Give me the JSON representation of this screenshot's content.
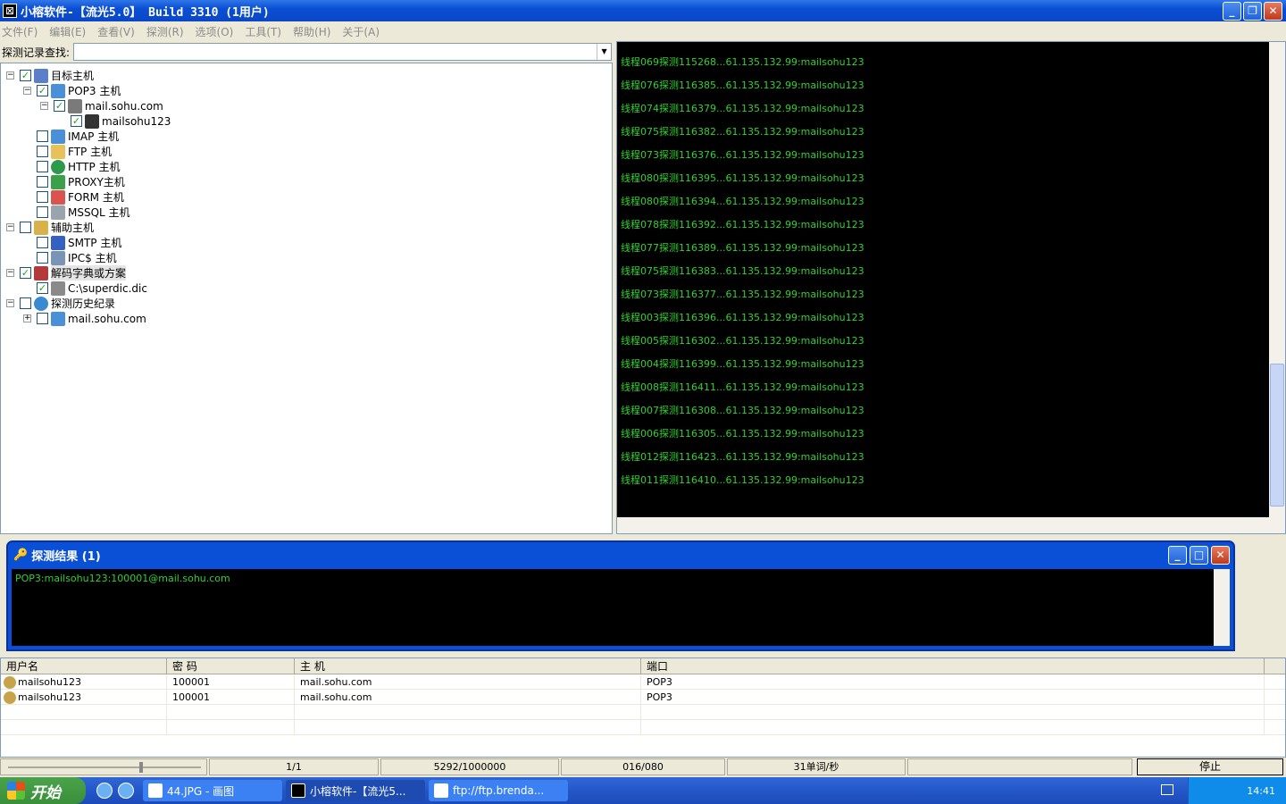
{
  "window": {
    "title": "小榕软件-【流光5.0】 Build 3310 (1用户)"
  },
  "menu": [
    "文件(F)",
    "编辑(E)",
    "查看(V)",
    "探测(R)",
    "选项(O)",
    "工具(T)",
    "帮助(H)",
    "关于(A)"
  ],
  "search": {
    "label": "探测记录查找:",
    "value": ""
  },
  "tree": {
    "target_hosts": "目标主机",
    "pop3": "POP3 主机",
    "mail_sohu": "mail.sohu.com",
    "mailsohu123": "mailsohu123",
    "imap": "IMAP 主机",
    "ftp": "FTP 主机",
    "http": "HTTP 主机",
    "proxy": "PROXY主机",
    "form": "FORM 主机",
    "mssql": "MSSQL 主机",
    "aux_hosts": "辅助主机",
    "smtp": "SMTP 主机",
    "ipc": "IPC$ 主机",
    "dict": "解码字典或方案",
    "dict_file": "C:\\superdic.dic",
    "history": "探测历史纪录",
    "history_host": "mail.sohu.com"
  },
  "console_lines": [
    "线程069探测115268...61.135.132.99:mailsohu123",
    "线程076探测116385...61.135.132.99:mailsohu123",
    "线程074探测116379...61.135.132.99:mailsohu123",
    "线程075探测116382...61.135.132.99:mailsohu123",
    "线程073探测116376...61.135.132.99:mailsohu123",
    "线程080探测116395...61.135.132.99:mailsohu123",
    "线程080探测116394...61.135.132.99:mailsohu123",
    "线程078探测116392...61.135.132.99:mailsohu123",
    "线程077探测116389...61.135.132.99:mailsohu123",
    "线程075探测116383...61.135.132.99:mailsohu123",
    "线程073探测116377...61.135.132.99:mailsohu123",
    "线程003探测116396...61.135.132.99:mailsohu123",
    "线程005探测116302...61.135.132.99:mailsohu123",
    "线程004探测116399...61.135.132.99:mailsohu123",
    "线程008探测116411...61.135.132.99:mailsohu123",
    "线程007探测116308...61.135.132.99:mailsohu123",
    "线程006探测116305...61.135.132.99:mailsohu123",
    "线程012探测116423...61.135.132.99:mailsohu123",
    "线程011探测116410...61.135.132.99:mailsohu123"
  ],
  "result_window": {
    "title": "探测结果 (1)",
    "text": "POP3:mailsohu123:100001@mail.sohu.com"
  },
  "grid": {
    "headers": [
      "用户名",
      "密 码",
      "主 机",
      "端口"
    ],
    "rows": [
      [
        "mailsohu123",
        "100001",
        "mail.sohu.com",
        "POP3"
      ],
      [
        "mailsohu123",
        "100001",
        "mail.sohu.com",
        "POP3"
      ]
    ]
  },
  "status": {
    "page": "1/1",
    "progress": "5292/1000000",
    "threads": "016/080",
    "rate": "31单词/秒",
    "stop": "停止"
  },
  "taskbar": {
    "start": "开始",
    "tasks": [
      "44.JPG - 画图",
      "小榕软件-【流光5...",
      "ftp://ftp.brenda..."
    ],
    "time": "14:41"
  },
  "colors": {
    "console_text": "#2fd22f",
    "title_blue": "#0a4fd4"
  }
}
